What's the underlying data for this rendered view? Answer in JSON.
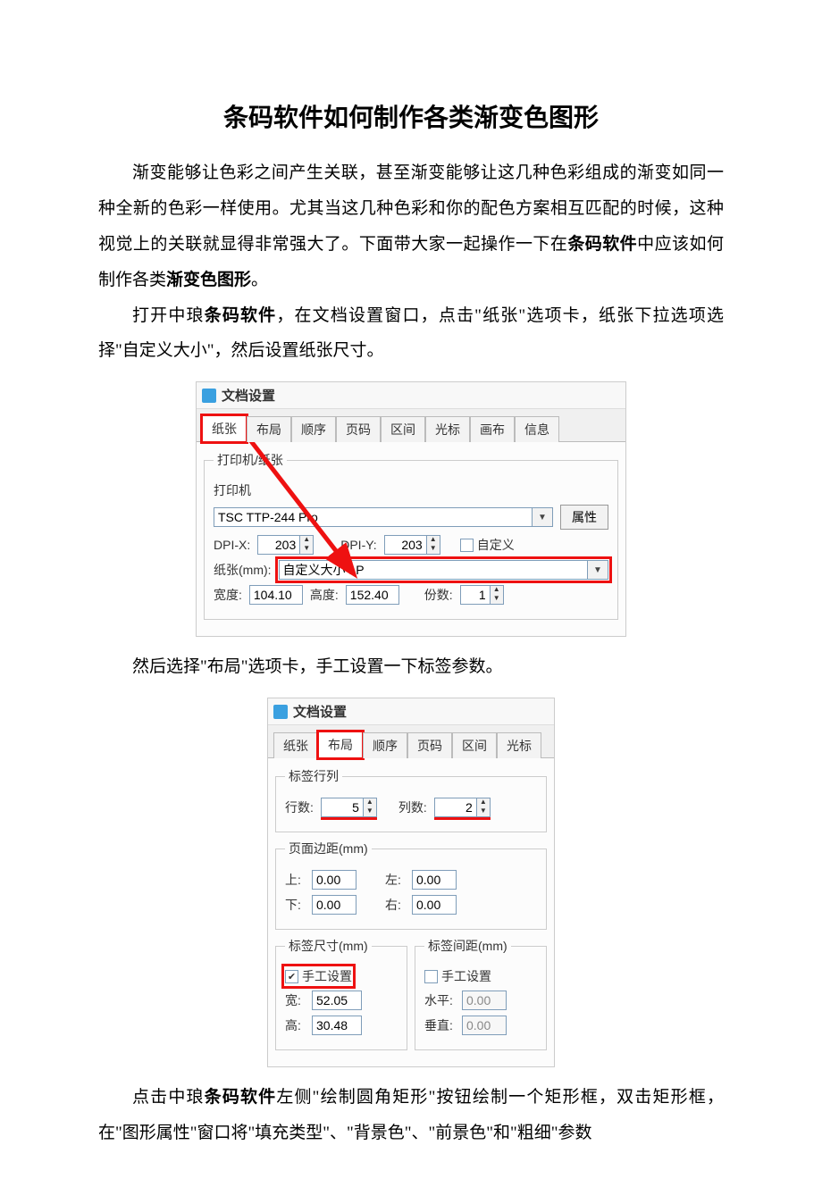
{
  "title": "条码软件如何制作各类渐变色图形",
  "para1_a": "渐变能够让色彩之间产生关联，甚至渐变能够让这几种色彩组成的渐变如同一种全新的色彩一样使用。尤其当这几种色彩和你的配色方案相互匹配的时候，这种视觉上的关联就显得非常强大了。下面带大家一起操作一下在",
  "para1_b": "条码软件",
  "para1_c": "中应该如何制作各类",
  "para1_d": "渐变色图形",
  "para1_e": "。",
  "para2_a": "打开中琅",
  "para2_b": "条码软件",
  "para2_c": "，在文档设置窗口，点击\"纸张\"选项卡，纸张下拉选项选择\"自定义大小\"，然后设置纸张尺寸。",
  "para3": "然后选择\"布局\"选项卡，手工设置一下标签参数。",
  "para4_a": "点击中琅",
  "para4_b": "条码软件",
  "para4_c": "左侧\"绘制圆角矩形\"按钮绘制一个矩形框，双击矩形框，在\"图形属性\"窗口将\"填充类型\"、\"背景色\"、\"前景色\"和\"粗细\"参数",
  "dlg_title": "文档设置",
  "tabs": {
    "paper": "纸张",
    "layout": "布局",
    "order": "顺序",
    "page": "页码",
    "range": "区间",
    "cursor": "光标",
    "canvas": "画布",
    "info": "信息"
  },
  "dlg1": {
    "grp_printer": "打印机/纸张",
    "printer_label": "打印机",
    "printer_value": "TSC TTP-244 Pro",
    "prop_btn": "属性",
    "dpix_label": "DPI-X:",
    "dpix_value": "203",
    "dpiy_label": "DPI-Y:",
    "dpiy_value": "203",
    "custom_chk": "自定义",
    "paper_label": "纸张(mm):",
    "paper_value": "自定义大小 LP",
    "width_label": "宽度:",
    "width_value": "104.10",
    "height_label": "高度:",
    "height_value": "152.40",
    "copies_label": "份数:",
    "copies_value": "1"
  },
  "dlg2": {
    "grp_rowcol": "标签行列",
    "rows_label": "行数:",
    "rows_value": "5",
    "cols_label": "列数:",
    "cols_value": "2",
    "grp_margin": "页面边距(mm)",
    "top_label": "上:",
    "top_value": "0.00",
    "left_label": "左:",
    "left_value": "0.00",
    "bottom_label": "下:",
    "bottom_value": "0.00",
    "right_label": "右:",
    "right_value": "0.00",
    "grp_size": "标签尺寸(mm)",
    "manual_chk": "手工设置",
    "w_label": "宽:",
    "w_value": "52.05",
    "h_label": "高:",
    "h_value": "30.48",
    "grp_gap": "标签间距(mm)",
    "manual_chk2": "手工设置",
    "horiz_label": "水平:",
    "horiz_value": "0.00",
    "vert_label": "垂直:",
    "vert_value": "0.00"
  }
}
